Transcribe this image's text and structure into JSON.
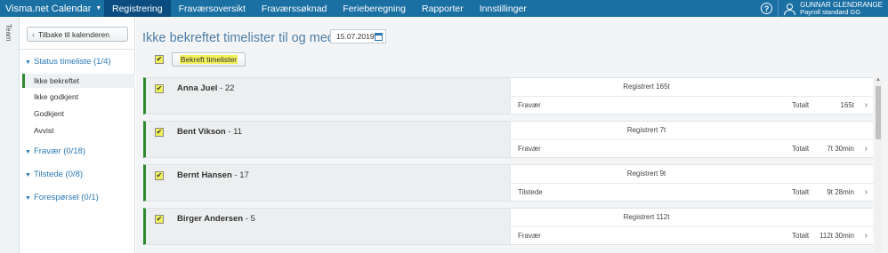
{
  "topbar": {
    "brand": "Visma.net Calendar",
    "tabs": [
      "Registrering",
      "Fraværsoversikt",
      "Fraværssøknad",
      "Ferieberegning",
      "Rapporter",
      "Innstillinger"
    ],
    "active_tab": "Registrering",
    "help": "?",
    "user_name": "GUNNAR GLENDRANGE",
    "user_role": "Payroll standard GG"
  },
  "team_label": "Team",
  "sidebar": {
    "back_label": "Tilbake til kalenderen",
    "status_title": "Status timeliste (1/4)",
    "status_items": [
      "Ikke bekreftet",
      "Ikke godkjent",
      "Godkjent",
      "Avvist"
    ],
    "groups": [
      "Fravær (0/18)",
      "Tilstede (0/8)",
      "Forespørsel (0/1)"
    ]
  },
  "main": {
    "title": "Ikke bekreftet timelister til og med",
    "date": "15.07.2019",
    "confirm_label": "Bekreft timelister",
    "total_label": "Totalt",
    "employees": [
      {
        "name": "Anna Juel",
        "id": " - 22",
        "registered": "Registrert 165t",
        "type": "Fravær",
        "total": "165t"
      },
      {
        "name": "Bent Vikson",
        "id": " - 11",
        "registered": "Registrert 7t",
        "type": "Fravær",
        "total": "7t 30min"
      },
      {
        "name": "Bernt Hansen",
        "id": " - 17",
        "registered": "Registrert 9t",
        "type": "Tilstede",
        "total": "9t 28min"
      },
      {
        "name": "Birger Andersen",
        "id": " - 5",
        "registered": "Registrert 112t",
        "type": "Fravær",
        "total": "112t 30min"
      }
    ]
  },
  "colors": {
    "nav": "#1a6fa3",
    "accent_green": "#2e8a30",
    "highlight": "#f2f05a"
  }
}
